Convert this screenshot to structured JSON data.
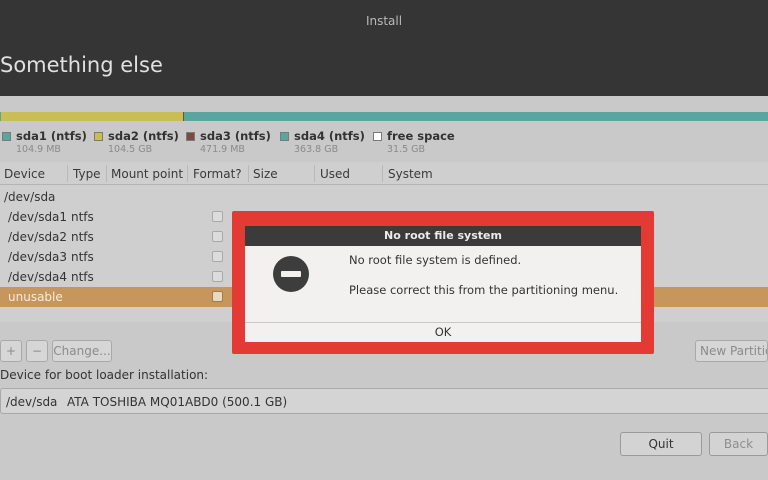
{
  "window": {
    "title": "Install"
  },
  "page": {
    "heading": "Something else"
  },
  "partition_bar": [
    {
      "name": "sda1",
      "color": "#5aa69e",
      "fraction": 0.0
    },
    {
      "name": "sda2",
      "color": "#c9be55",
      "fraction": 0.237
    },
    {
      "name": "sda3",
      "color": "#7a4b43",
      "fraction": 0.001
    },
    {
      "name": "sda4",
      "color": "#5aa69e",
      "fraction": 0.762
    }
  ],
  "legend": [
    {
      "name": "sda1 (ntfs)",
      "size": "104.9 MB",
      "color": "#5aa69e",
      "icon": "teal-swatch"
    },
    {
      "name": "sda2 (ntfs)",
      "size": "104.5 GB",
      "color": "#c9be55",
      "icon": "yellow-swatch"
    },
    {
      "name": "sda3 (ntfs)",
      "size": "471.9 MB",
      "color": "#7a4b43",
      "icon": "brown-swatch"
    },
    {
      "name": "sda4 (ntfs)",
      "size": "363.8 GB",
      "color": "#5aa69e",
      "icon": "teal-swatch"
    },
    {
      "name": "free space",
      "size": "31.5 GB",
      "color": "#ffffff",
      "icon": "empty-swatch"
    }
  ],
  "table": {
    "headers": [
      "Device",
      "Type",
      "Mount point",
      "Format?",
      "Size",
      "Used",
      "System"
    ],
    "group": "/dev/sda",
    "rows": [
      {
        "device": "/dev/sda1",
        "type": "ntfs"
      },
      {
        "device": "/dev/sda2",
        "type": "ntfs"
      },
      {
        "device": "/dev/sda3",
        "type": "ntfs"
      },
      {
        "device": "/dev/sda4",
        "type": "ntfs"
      },
      {
        "device": "unusable",
        "type": "",
        "selected": true
      }
    ]
  },
  "toolbar": {
    "add_label": "+",
    "remove_label": "−",
    "change_label": "Change...",
    "new_table_label": "New Partition Table..."
  },
  "boot_loader": {
    "label": "Device for boot loader installation:",
    "device": "/dev/sda",
    "description": "ATA TOSHIBA MQ01ABD0 (500.1 GB)"
  },
  "nav": {
    "quit_label": "Quit",
    "back_label": "Back"
  },
  "dialog": {
    "title": "No root file system",
    "message": "No root file system is defined.",
    "detail": "Please correct this from the partitioning menu.",
    "ok_label": "OK",
    "icon": "stop-icon",
    "highlight_color": "#e33a33"
  }
}
